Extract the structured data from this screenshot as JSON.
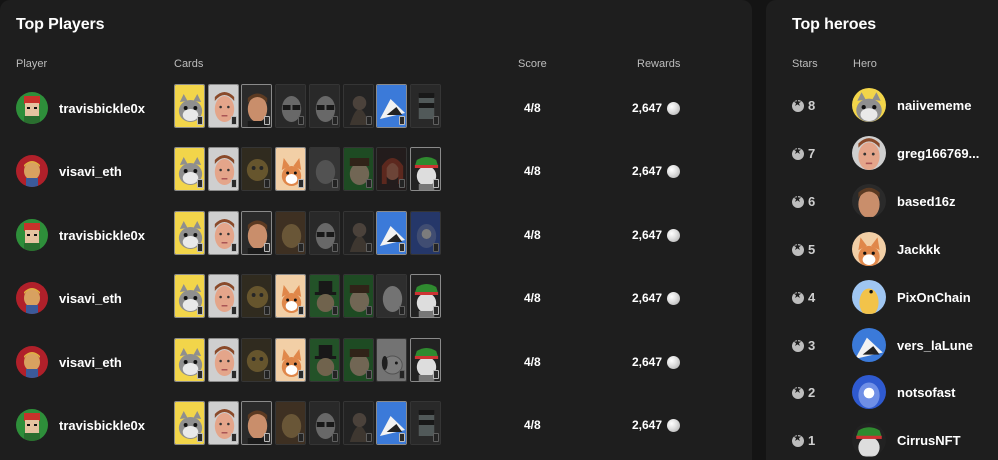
{
  "players_panel": {
    "title": "Top Players",
    "columns": {
      "player": "Player",
      "cards": "Cards",
      "score": "Score",
      "rewards": "Rewards"
    },
    "rows": [
      {
        "name": "travisbickle0x",
        "avatar": "pixel-punk-avatar",
        "score": "4/8",
        "reward": "2,647",
        "cards": [
          {
            "art": "cat",
            "dim": false
          },
          {
            "art": "face",
            "dim": false
          },
          {
            "art": "man",
            "dim": false
          },
          {
            "art": "glasses",
            "dim": true
          },
          {
            "art": "glasses",
            "dim": true
          },
          {
            "art": "dark",
            "dim": true
          },
          {
            "art": "blueshark",
            "dim": false
          },
          {
            "art": "punk",
            "dim": true
          }
        ]
      },
      {
        "name": "visavi_eth",
        "avatar": "van-gogh-avatar",
        "score": "4/8",
        "reward": "2,647",
        "cards": [
          {
            "art": "cat",
            "dim": false
          },
          {
            "art": "face",
            "dim": false
          },
          {
            "art": "gold",
            "dim": true
          },
          {
            "art": "shiba",
            "dim": false
          },
          {
            "art": "gray",
            "dim": true
          },
          {
            "art": "green",
            "dim": true
          },
          {
            "art": "red",
            "dim": true
          },
          {
            "art": "hat",
            "dim": false
          }
        ]
      },
      {
        "name": "travisbickle0x",
        "avatar": "pixel-punk-avatar",
        "score": "4/8",
        "reward": "2,647",
        "cards": [
          {
            "art": "cat",
            "dim": false
          },
          {
            "art": "face",
            "dim": false
          },
          {
            "art": "man",
            "dim": false
          },
          {
            "art": "orange",
            "dim": true
          },
          {
            "art": "glasses",
            "dim": true
          },
          {
            "art": "dark",
            "dim": true
          },
          {
            "art": "blueshark",
            "dim": false
          },
          {
            "art": "blue",
            "dim": true
          }
        ]
      },
      {
        "name": "visavi_eth",
        "avatar": "van-gogh-avatar",
        "score": "4/8",
        "reward": "2,647",
        "cards": [
          {
            "art": "cat",
            "dim": false
          },
          {
            "art": "face",
            "dim": false
          },
          {
            "art": "gold",
            "dim": true
          },
          {
            "art": "shiba",
            "dim": false
          },
          {
            "art": "tophat",
            "dim": true
          },
          {
            "art": "green",
            "dim": true
          },
          {
            "art": "white",
            "dim": true
          },
          {
            "art": "hat",
            "dim": false
          }
        ]
      },
      {
        "name": "visavi_eth",
        "avatar": "van-gogh-avatar",
        "score": "4/8",
        "reward": "2,647",
        "cards": [
          {
            "art": "cat",
            "dim": false
          },
          {
            "art": "face",
            "dim": false
          },
          {
            "art": "gold",
            "dim": true
          },
          {
            "art": "shiba",
            "dim": false
          },
          {
            "art": "tophat",
            "dim": true
          },
          {
            "art": "green",
            "dim": true
          },
          {
            "art": "snoopy",
            "dim": true
          },
          {
            "art": "hat",
            "dim": false
          }
        ]
      },
      {
        "name": "travisbickle0x",
        "avatar": "pixel-punk-avatar",
        "score": "4/8",
        "reward": "2,647",
        "cards": [
          {
            "art": "cat",
            "dim": false
          },
          {
            "art": "face",
            "dim": false
          },
          {
            "art": "man",
            "dim": false
          },
          {
            "art": "orange",
            "dim": true
          },
          {
            "art": "glasses",
            "dim": true
          },
          {
            "art": "dark",
            "dim": true
          },
          {
            "art": "blueshark",
            "dim": false
          },
          {
            "art": "punk",
            "dim": true
          }
        ]
      }
    ]
  },
  "heroes_panel": {
    "title": "Top heroes",
    "columns": {
      "stars": "Stars",
      "hero": "Hero"
    },
    "rows": [
      {
        "stars": "8",
        "name": "naiivememe",
        "avatar": "cat"
      },
      {
        "stars": "7",
        "name": "greg166769...",
        "avatar": "face"
      },
      {
        "stars": "6",
        "name": "based16z",
        "avatar": "man"
      },
      {
        "stars": "5",
        "name": "Jackkk",
        "avatar": "shiba"
      },
      {
        "stars": "4",
        "name": "PixOnChain",
        "avatar": "duck"
      },
      {
        "stars": "3",
        "name": "vers_laLune",
        "avatar": "blueshark"
      },
      {
        "stars": "2",
        "name": "notsofast",
        "avatar": "blue"
      },
      {
        "stars": "1",
        "name": "CirrusNFT",
        "avatar": "hat"
      }
    ]
  },
  "colors": {
    "panel": "#1e1e1e",
    "background": "#141414",
    "text": "#ffffff",
    "muted": "#bdbdbd"
  }
}
